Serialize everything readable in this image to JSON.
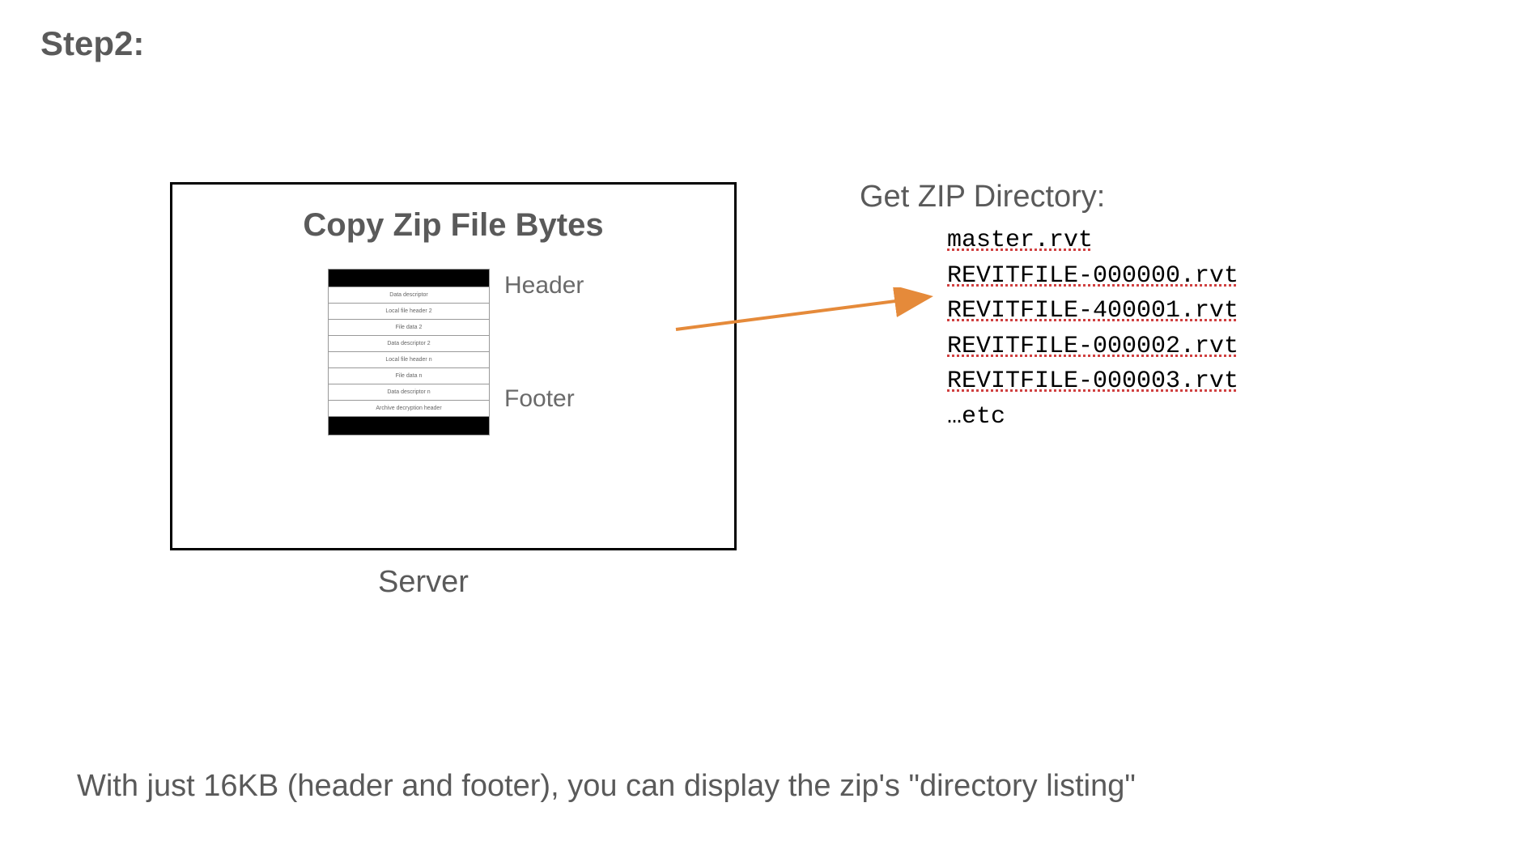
{
  "step_title": "Step2:",
  "server": {
    "title": "Copy Zip File Bytes",
    "header_label": "Header",
    "footer_label": "Footer",
    "label": "Server",
    "rows": {
      "r1": "Data descriptor",
      "r2": "Local file header 2",
      "r3": "File data 2",
      "r4": "Data descriptor 2",
      "r5": "Local file header n",
      "r6": "File data n",
      "r7": "Data descriptor n",
      "r8": "Archive decryption header"
    }
  },
  "directory": {
    "title": "Get ZIP Directory:",
    "files": {
      "f0": "master.rvt",
      "f1": "REVITFILE-000000.rvt",
      "f2": "REVITFILE-400001.rvt",
      "f3": "REVITFILE-000002.rvt",
      "f4": "REVITFILE-000003.rvt",
      "f5": "…etc"
    }
  },
  "caption": "With just 16KB (header and footer), you can display the zip's \"directory listing\"",
  "arrow_color": "#e58a3a"
}
